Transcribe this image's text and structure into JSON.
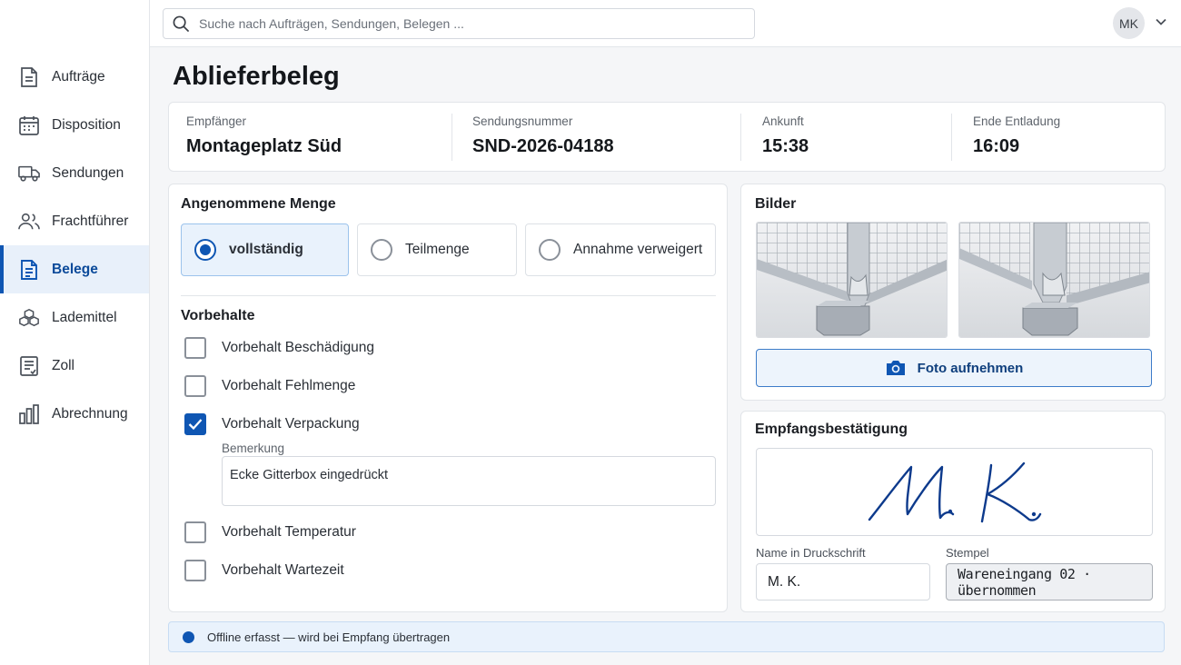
{
  "search": {
    "placeholder": "Suche nach Aufträgen, Sendungen, Belegen ..."
  },
  "user": {
    "initials": "MK"
  },
  "sidebar": {
    "items": [
      {
        "label": "Aufträge",
        "icon": "document-icon",
        "active": false
      },
      {
        "label": "Disposition",
        "icon": "calendar-icon",
        "active": false
      },
      {
        "label": "Sendungen",
        "icon": "truck-icon",
        "active": false
      },
      {
        "label": "Frachtführer",
        "icon": "users-icon",
        "active": false
      },
      {
        "label": "Belege",
        "icon": "receipt-icon",
        "active": true
      },
      {
        "label": "Lademittel",
        "icon": "boxes-icon",
        "active": false
      },
      {
        "label": "Zoll",
        "icon": "customs-doc-icon",
        "active": false
      },
      {
        "label": "Abrechnung",
        "icon": "bar-chart-icon",
        "active": false
      }
    ]
  },
  "page": {
    "title": "Ablieferbeleg"
  },
  "summary": {
    "recipient_label": "Empfänger",
    "recipient": "Montageplatz Süd",
    "shipment_label": "Sendungsnummer",
    "shipment": "SND-2026-04188",
    "arrival_label": "Ankunft",
    "arrival": "15:38",
    "unload_end_label": "Ende Entladung",
    "unload_end": "16:09"
  },
  "quantity": {
    "title": "Angenommene Menge",
    "options": [
      "vollständig",
      "Teilmenge",
      "Annahme verweigert"
    ],
    "selected": "vollständig"
  },
  "reservations": {
    "title": "Vorbehalte",
    "items": [
      {
        "label": "Vorbehalt Beschädigung",
        "checked": false
      },
      {
        "label": "Vorbehalt Fehlmenge",
        "checked": false
      },
      {
        "label": "Vorbehalt Verpackung",
        "checked": true
      },
      {
        "label": "Vorbehalt Temperatur",
        "checked": false
      },
      {
        "label": "Vorbehalt Wartezeit",
        "checked": false
      }
    ],
    "remark_label": "Bemerkung",
    "remark_value": "Ecke Gitterbox eingedrückt"
  },
  "images": {
    "title": "Bilder",
    "button_label": "Foto aufnehmen"
  },
  "confirmation": {
    "title": "Empfangsbestätigung",
    "signature": "M. K.",
    "name_label": "Name in Druckschrift",
    "name_value": "M. K.",
    "stamp_label": "Stempel",
    "stamp_value": "Wareneingang 02 · übernommen"
  },
  "status": {
    "text": "Offline erfasst — wird bei Empfang übertragen"
  },
  "colors": {
    "accent": "#0f56b3",
    "selected_bg": "#e9f2fc",
    "signature_ink": "#0d3a8c"
  }
}
